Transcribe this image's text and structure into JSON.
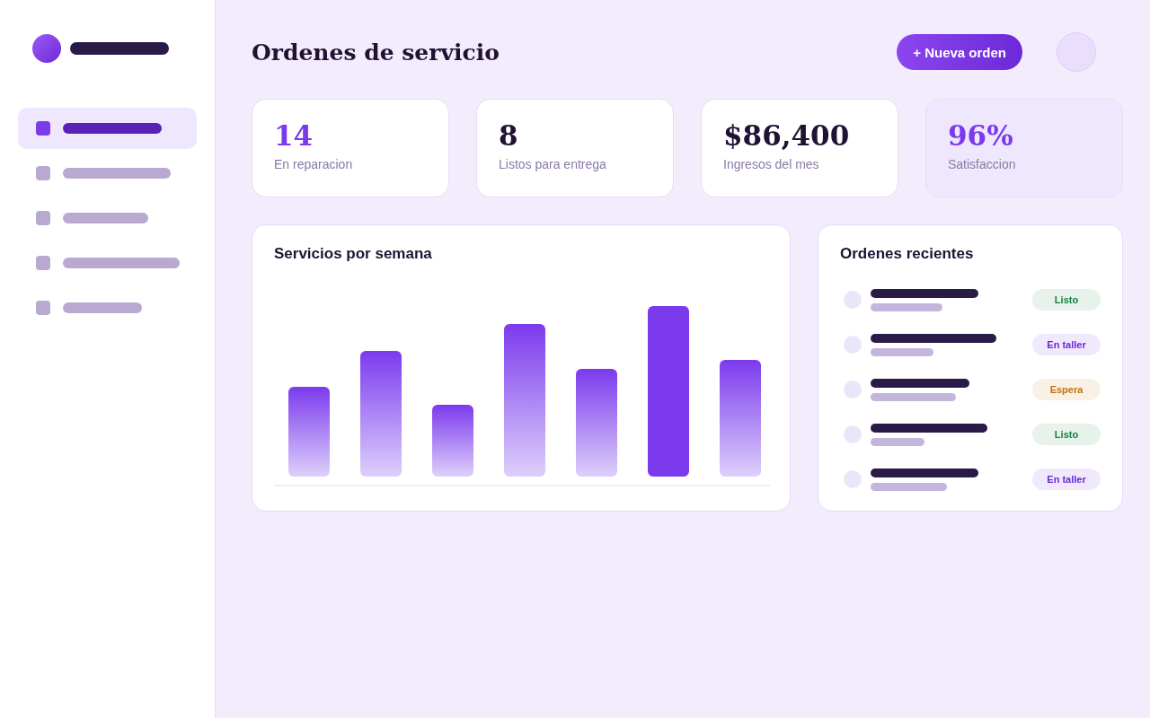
{
  "sidebar": {
    "items": [
      {
        "selected": true
      },
      {
        "selected": false
      },
      {
        "selected": false
      },
      {
        "selected": false
      },
      {
        "selected": false
      }
    ]
  },
  "header": {
    "title": "Ordenes de servicio",
    "button": "+ Nueva orden"
  },
  "stats": [
    {
      "value": "14",
      "label": "En reparacion",
      "accent": true,
      "highlighted": false
    },
    {
      "value": "8",
      "label": "Listos para entrega",
      "accent": false,
      "highlighted": false
    },
    {
      "value": "$86,400",
      "label": "Ingresos del mes",
      "accent": false,
      "highlighted": false
    },
    {
      "value": "96%",
      "label": "Satisfaccion",
      "accent": true,
      "highlighted": true
    }
  ],
  "chart_panel": {
    "title": "Servicios por semana"
  },
  "recent": {
    "title": "Ordenes recientes",
    "rows": [
      {
        "status": "Listo",
        "color": "#15803d"
      },
      {
        "status": "En taller",
        "color": "#6d28d9"
      },
      {
        "status": "Espera",
        "color": "#c2710c"
      },
      {
        "status": "Listo",
        "color": "#15803d"
      },
      {
        "status": "En taller",
        "color": "#6d28d9"
      }
    ]
  }
}
